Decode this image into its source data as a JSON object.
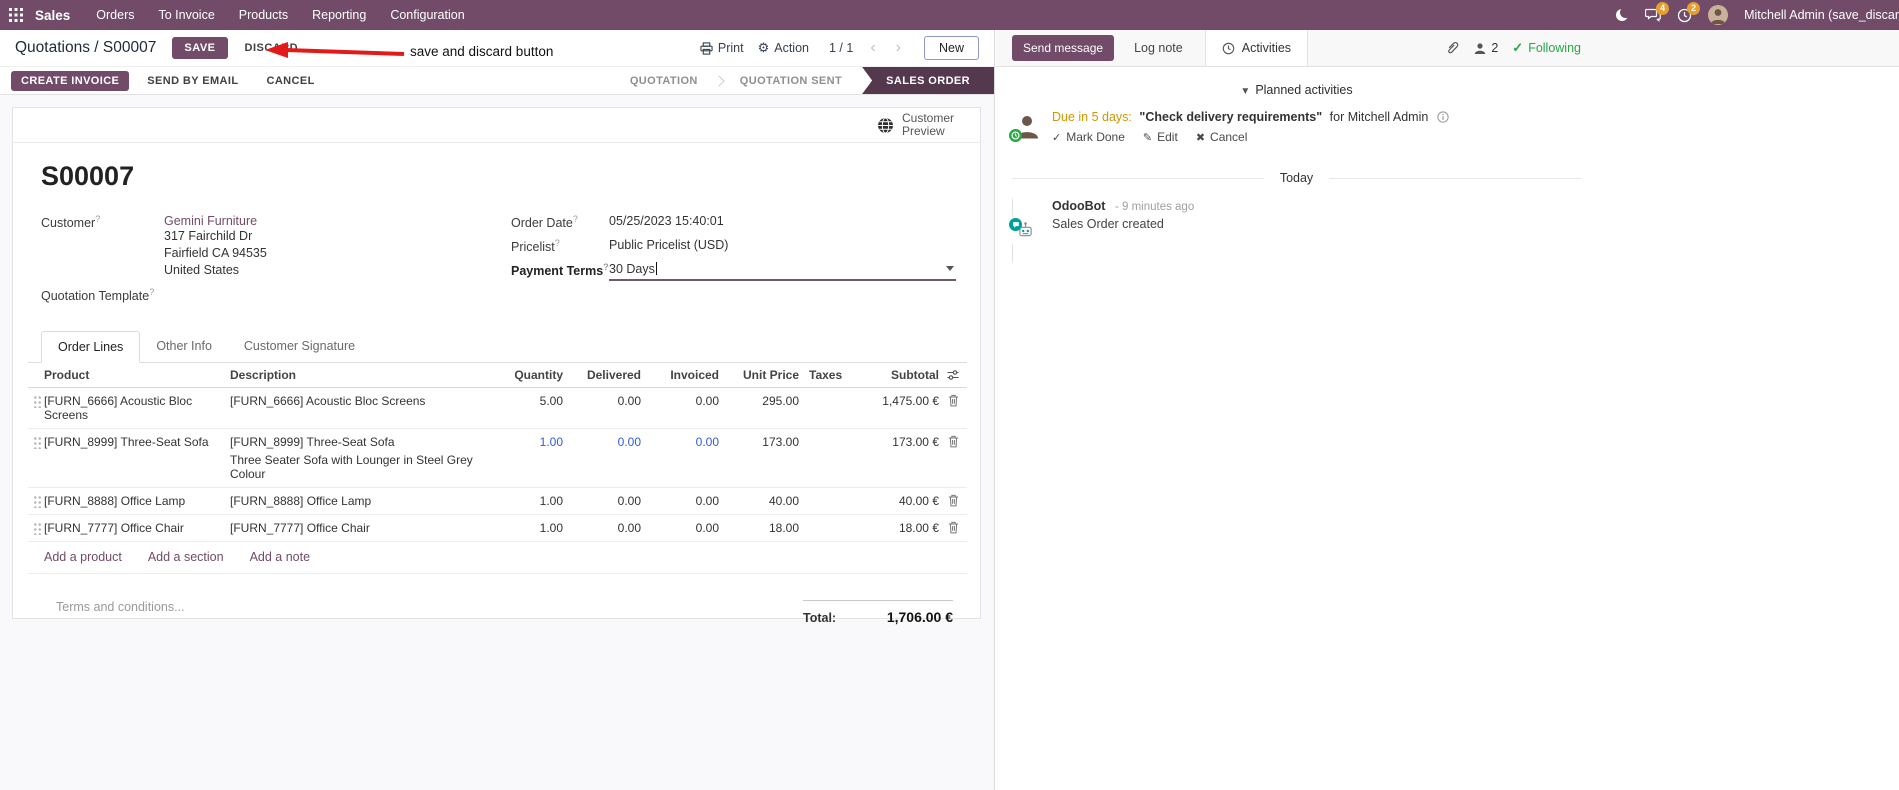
{
  "colors": {
    "accent": "#714B67",
    "active_stage_bg": "#54384e",
    "modified_field_blue": "#2e5ed1",
    "annotation_red": "#e21a1a",
    "following_green": "#28a745",
    "badge_orange": "#e49f2f",
    "due_soon_orange": "#cf9700"
  },
  "nav": {
    "app_name": "Sales",
    "menus": [
      "Orders",
      "To Invoice",
      "Products",
      "Reporting",
      "Configuration"
    ],
    "messages_badge": "4",
    "activities_badge": "2",
    "user_name": "Mitchell Admin (save_discar"
  },
  "control_panel": {
    "breadcrumb_parent": "Quotations",
    "breadcrumb_sep": "/",
    "breadcrumb_current": "S00007",
    "save": "SAVE",
    "discard": "DISCARD",
    "print": "Print",
    "action": "Action",
    "pager": "1 / 1",
    "prev": "‹",
    "next": "›",
    "new": "New"
  },
  "annotation": {
    "text": "save and discard button"
  },
  "statusbar": {
    "create_invoice": "CREATE INVOICE",
    "send_by_email": "SEND BY EMAIL",
    "cancel": "CANCEL",
    "stages": [
      {
        "label": "QUOTATION"
      },
      {
        "label": "QUOTATION SENT"
      },
      {
        "label": "SALES ORDER"
      }
    ]
  },
  "form": {
    "customer_preview": "Customer Preview",
    "title": "S00007",
    "hint": "?",
    "customer": {
      "label": "Customer",
      "name": "Gemini Furniture",
      "address": [
        "317 Fairchild Dr",
        "Fairfield CA 94535",
        "United States"
      ]
    },
    "quotation_template_label": "Quotation Template",
    "order_date": {
      "label": "Order Date",
      "value": "05/25/2023 15:40:01"
    },
    "pricelist": {
      "label": "Pricelist",
      "value": "Public Pricelist (USD)"
    },
    "payment_terms": {
      "label": "Payment Terms",
      "value": "30 Days"
    },
    "tabs": [
      {
        "label": "Order Lines"
      },
      {
        "label": "Other Info"
      },
      {
        "label": "Customer Signature"
      }
    ],
    "table": {
      "headers": {
        "product": "Product",
        "description": "Description",
        "quantity": "Quantity",
        "delivered": "Delivered",
        "invoiced": "Invoiced",
        "unit_price": "Unit Price",
        "taxes": "Taxes",
        "subtotal": "Subtotal"
      },
      "rows": [
        {
          "product": "[FURN_6666] Acoustic Bloc Screens",
          "description": "[FURN_6666] Acoustic Bloc Screens",
          "description2": "",
          "quantity": "5.00",
          "delivered": "0.00",
          "invoiced": "0.00",
          "unit_price": "295.00",
          "subtotal": "1,475.00 €"
        },
        {
          "product": "[FURN_8999] Three-Seat Sofa",
          "description": "[FURN_8999] Three-Seat Sofa",
          "description2": "Three Seater Sofa with Lounger in Steel Grey Colour",
          "quantity": "1.00",
          "delivered": "0.00",
          "invoiced": "0.00",
          "unit_price": "173.00",
          "subtotal": "173.00 €"
        },
        {
          "product": "[FURN_8888] Office Lamp",
          "description": "[FURN_8888] Office Lamp",
          "description2": "",
          "quantity": "1.00",
          "delivered": "0.00",
          "invoiced": "0.00",
          "unit_price": "40.00",
          "subtotal": "40.00 €"
        },
        {
          "product": "[FURN_7777] Office Chair",
          "description": "[FURN_7777] Office Chair",
          "description2": "",
          "quantity": "1.00",
          "delivered": "0.00",
          "invoiced": "0.00",
          "unit_price": "18.00",
          "subtotal": "18.00 €"
        }
      ],
      "add_product": "Add a product",
      "add_section": "Add a section",
      "add_note": "Add a note"
    },
    "terms_placeholder": "Terms and conditions...",
    "total_label": "Total:",
    "total_value": "1,706.00 €"
  },
  "chatter": {
    "send_message": "Send message",
    "log_note": "Log note",
    "activities": "Activities",
    "followers_count": "2",
    "following": "Following",
    "planned_title": "Planned activities",
    "activity": {
      "due": "Due in 5 days:",
      "summary": "\"Check delivery requirements\"",
      "assignee": "for Mitchell Admin",
      "mark_done": "Mark Done",
      "edit": "Edit",
      "cancel": "Cancel"
    },
    "day_divider": "Today",
    "message": {
      "author": "OdooBot",
      "time": "- 9 minutes ago",
      "body": "Sales Order created"
    }
  }
}
